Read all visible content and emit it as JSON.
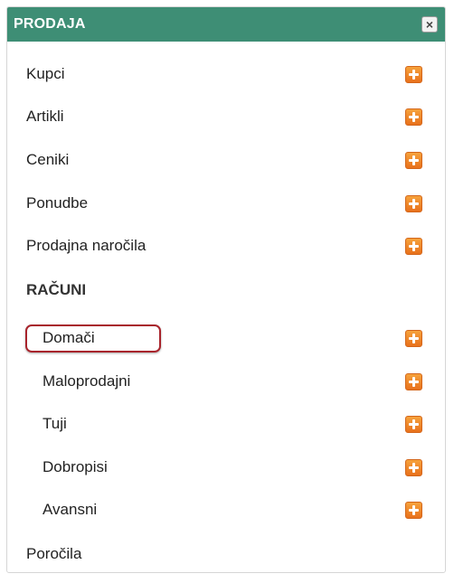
{
  "panel": {
    "title": "PRODAJA",
    "close_glyph": "×"
  },
  "menu": {
    "items": [
      {
        "label": "Kupci",
        "icon": "plus-icon"
      },
      {
        "label": "Artikli",
        "icon": "plus-icon"
      },
      {
        "label": "Ceniki",
        "icon": "plus-icon"
      },
      {
        "label": "Ponudbe",
        "icon": "plus-icon"
      },
      {
        "label": "Prodajna naročila",
        "icon": "plus-icon"
      }
    ],
    "section": {
      "title": "RAČUNI",
      "items": [
        {
          "label": "Domači",
          "icon": "plus-icon",
          "highlighted": true
        },
        {
          "label": "Maloprodajni",
          "icon": "plus-icon"
        },
        {
          "label": "Tuji",
          "icon": "plus-icon"
        },
        {
          "label": "Dobropisi",
          "icon": "plus-icon"
        },
        {
          "label": "Avansni",
          "icon": "plus-icon"
        }
      ]
    },
    "footer_item": {
      "label": "Poročila"
    }
  },
  "colors": {
    "header_bg": "#3e8e75",
    "plus_icon": "#f08a2a",
    "highlight_border": "#a8242c"
  }
}
